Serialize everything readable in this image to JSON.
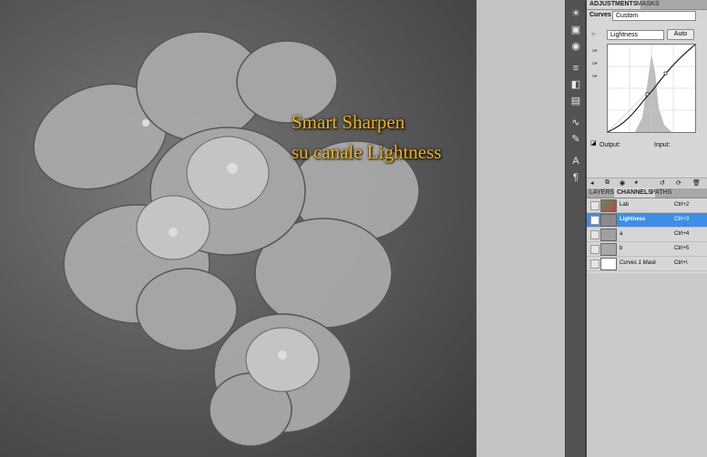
{
  "image_overlay": {
    "line1": "Smart Sharpen",
    "line2": "su canale Lightness",
    "text_color": "#f5b400"
  },
  "tools": [
    "sun-icon",
    "picture-icon",
    "target-icon",
    "sliders-icon",
    "bw-icon",
    "levels-icon",
    "curves-icon",
    "brush-icon",
    "text-icon",
    "paragraph-icon"
  ],
  "adjustments": {
    "tabs": [
      "ADJUSTMENTS",
      "MASKS"
    ],
    "preset_label": "Curves",
    "preset_value": "Custom",
    "channel_value": "Lightness",
    "auto_button": "Auto",
    "output_label": "Output:",
    "input_label": "Input:"
  },
  "layers_panel": {
    "tabs": [
      "LAYERS",
      "CHANNELS",
      "PATHS"
    ],
    "channels": [
      {
        "name": "Lab",
        "shortcut": "Ctrl+2",
        "selected": false
      },
      {
        "name": "Lightness",
        "shortcut": "Ctrl+3",
        "selected": true
      },
      {
        "name": "a",
        "shortcut": "Ctrl+4",
        "selected": false
      },
      {
        "name": "b",
        "shortcut": "Ctrl+5",
        "selected": false
      },
      {
        "name": "Curves 1 Mask",
        "shortcut": "Ctrl+\\",
        "selected": false
      }
    ]
  },
  "colors": {
    "selection": "#3d8ee6",
    "panel_bg": "#d6d6d6"
  }
}
